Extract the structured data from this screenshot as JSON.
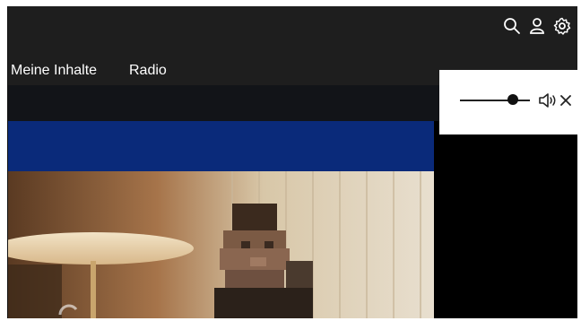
{
  "header": {
    "icons": [
      "search-icon",
      "user-icon",
      "gear-icon"
    ]
  },
  "nav": {
    "items": [
      {
        "label": "Meine Inhalte"
      },
      {
        "label": "Radio"
      }
    ]
  },
  "player": {
    "banner_color": "#0a2a7a",
    "volume": 0.75,
    "volume_icon": "speaker-icon",
    "close_icon": "close-icon"
  },
  "colors": {
    "background": "#1e1e1e",
    "band": "#121418",
    "panel": "#ffffff"
  }
}
